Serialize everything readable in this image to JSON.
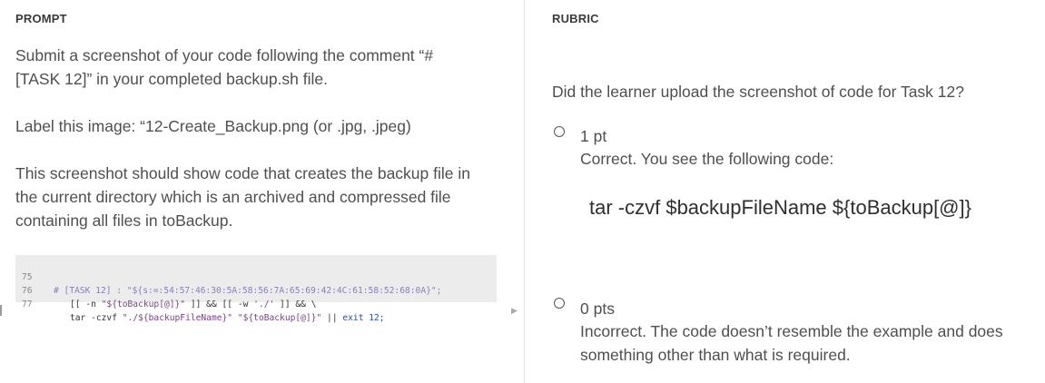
{
  "prompt": {
    "heading": "PROMPT",
    "para1_line1": "Submit a screenshot of your code following the comment “#",
    "para1_line2": "[TASK 12]” in your completed backup.sh file.",
    "para2": "Label this image: “12-Create_Backup.png (or .jpg, .jpeg)",
    "para3_line1": "This screenshot should show code that creates the backup file in",
    "para3_line2": "the current directory which is an archived and compressed file",
    "para3_line3": "containing all files in toBackup.",
    "code": {
      "line_numbers": [
        "75",
        "76",
        "77"
      ],
      "line75": "# [TASK 12] : \"${s:=:54:57:46:30:5A:58:56:7A:65:69:42:4C:61:58:52:68:0A}\";",
      "line76_a": "[[ -n ",
      "line76_b": "\"${toBackup[@]}\"",
      "line76_c": " ]] && [[ -w ",
      "line76_d": "'./'",
      "line76_e": " ]] && \\",
      "line77_a": "tar -czvf ",
      "line77_b": "\"./${backupFileName}\"",
      "line77_c": " ",
      "line77_d": "\"${toBackup[@]}\"",
      "line77_e": " || ",
      "line77_f": "exit 12;"
    }
  },
  "rubric": {
    "heading": "RUBRIC",
    "question": "Did the learner upload the screenshot of code for Task 12?",
    "options": [
      {
        "points": "1 pt",
        "description_line1": "Correct. You see the following code:",
        "code_example": "tar -czvf $backupFileName ${toBackup[@]}"
      },
      {
        "points": "0 pts",
        "description_line1": "Incorrect. The code doesn’t resemble the example and does",
        "description_line2": "something other than what is required."
      }
    ]
  },
  "icons": {
    "radio": "radio-unselected-icon",
    "scroll_right": "scroll-right-arrow-icon"
  },
  "colors": {
    "code_background": "#ececec",
    "text": "#4f4f4f",
    "divider": "#e3e3e3"
  }
}
